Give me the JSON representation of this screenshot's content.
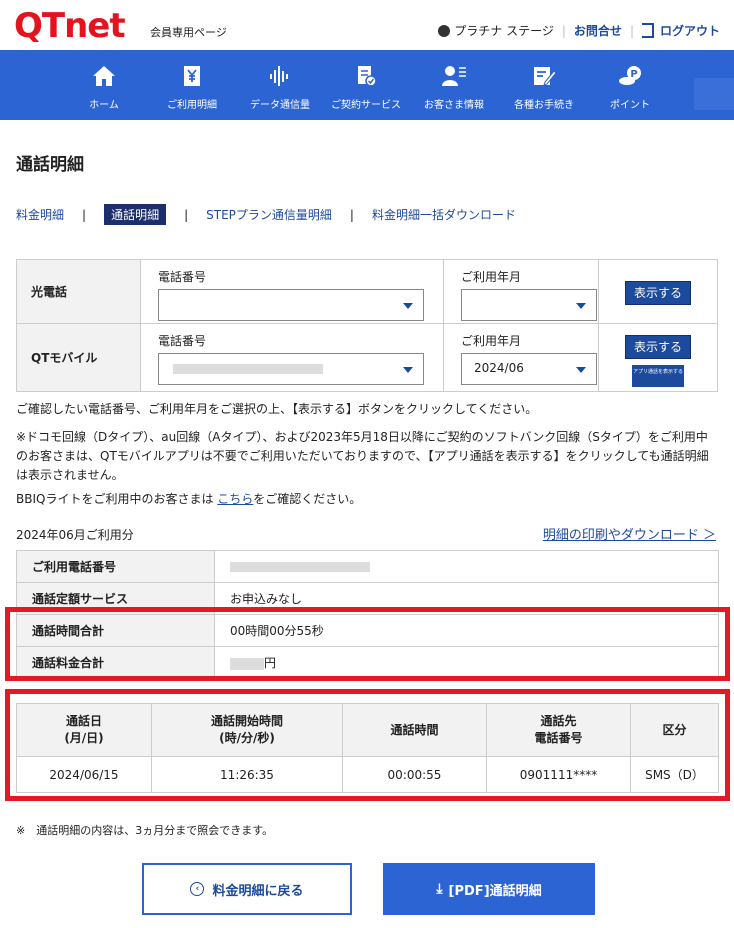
{
  "header": {
    "logo": "QTnet",
    "subtitle": "会員専用ページ",
    "stage": "プラチナ ステージ",
    "contact": "お問合せ",
    "logout": "ログアウト"
  },
  "nav": [
    {
      "label": "ホーム",
      "icon": "home-icon"
    },
    {
      "label": "ご利用明細",
      "icon": "yen-receipt-icon"
    },
    {
      "label": "データ通信量",
      "icon": "sound-wave-icon"
    },
    {
      "label": "ご契約サービス",
      "icon": "contract-icon"
    },
    {
      "label": "お客さま情報",
      "icon": "user-icon"
    },
    {
      "label": "各種お手続き",
      "icon": "edit-form-icon"
    },
    {
      "label": "ポイント",
      "icon": "coin-point-icon"
    }
  ],
  "page": {
    "title": "通話明細"
  },
  "subnav": {
    "billing": "料金明細",
    "calls": "通話明細",
    "step": "STEPプラン通信量明細",
    "download": "料金明細一括ダウンロード",
    "sep": "|"
  },
  "selector": {
    "hikari": {
      "label": "光電話",
      "phone_label": "電話番号",
      "phone_value": "",
      "month_label": "ご利用年月",
      "month_value": "",
      "button": "表示する"
    },
    "mobile": {
      "label": "QTモバイル",
      "phone_label": "電話番号",
      "month_label": "ご利用年月",
      "month_value": "2024/06",
      "button": "表示する",
      "app_button": "アプリ通話を表示する"
    }
  },
  "notes": {
    "n1": "ご確認したい電話番号、ご利用年月をご選択の上、【表示する】ボタンをクリックしてください。",
    "n2": "※ドコモ回線（Dタイプ）、au回線（Aタイプ）、および2023年5月18日以降にご契約のソフトバンク回線（Sタイプ）をご利用中のお客さまは、QTモバイルアプリは不要でご利用いただいておりますので、【アプリ通話を表示する】をクリックしても通話明細は表示されません。",
    "n3_pre": "BBIQライトをご利用中のお客さまは",
    "n3_link": "こちら",
    "n3_post": "をご確認ください。"
  },
  "summary": {
    "month": "2024年06月ご利用分",
    "print_link": "明細の印刷やダウンロード ＞",
    "rows": {
      "phone_label": "ご利用電話番号",
      "flat_label": "通話定額サービス",
      "flat_value": "お申込みなし",
      "time_label": "通話時間合計",
      "time_value": "00時間00分55秒",
      "fee_label": "通話料金合計",
      "fee_unit": "円"
    }
  },
  "detail": {
    "headers": {
      "date": [
        "通話日",
        "(月/日)"
      ],
      "start": [
        "通話開始時間",
        "(時/分/秒)"
      ],
      "duration": "通話時間",
      "dest": [
        "通話先",
        "電話番号"
      ],
      "type": "区分"
    },
    "rows": [
      {
        "date": "2024/06/15",
        "start": "11:26:35",
        "duration": "00:00:55",
        "dest": "0901111****",
        "type": "SMS（D）"
      }
    ]
  },
  "footer": {
    "note": "※　通話明細の内容は、3ヵ月分まで照会できます。",
    "back": "料金明細に戻る",
    "pdf": "[PDF]通話明細"
  },
  "colors": {
    "brand_red": "#e3141e",
    "nav_blue": "#2d64d3",
    "dark_navy": "#1c2f6b",
    "highlight_red": "#e41923"
  }
}
